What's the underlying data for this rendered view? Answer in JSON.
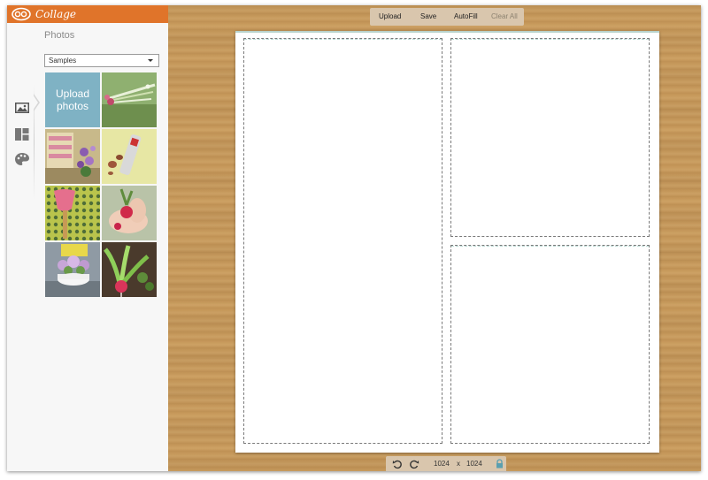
{
  "brand": {
    "name": "Collage",
    "color": "#e0742a"
  },
  "rail": {
    "items": [
      {
        "name": "photos",
        "icon": "image-icon"
      },
      {
        "name": "layouts",
        "icon": "layout-icon"
      },
      {
        "name": "design",
        "icon": "palette-icon"
      }
    ],
    "active": "photos"
  },
  "photos_panel": {
    "title": "Photos",
    "source": {
      "selected": "Samples"
    },
    "upload_label": "Upload photos",
    "thumbnails": [
      "sample-photo-tulip-bundle",
      "sample-photo-garden-chair-flowers",
      "sample-photo-seed-packet",
      "sample-photo-pink-trowel",
      "sample-photo-radish-in-hands",
      "sample-photo-flower-planter",
      "sample-photo-radish-sprout"
    ]
  },
  "toolbar": {
    "upload": "Upload",
    "save": "Save",
    "autofill": "AutoFill",
    "clear_all": "Clear All"
  },
  "canvas": {
    "cells": [
      "left-tall-cell",
      "top-right-cell",
      "bottom-right-cell"
    ]
  },
  "footer": {
    "width": "1024",
    "separator": "x",
    "height": "1024"
  }
}
